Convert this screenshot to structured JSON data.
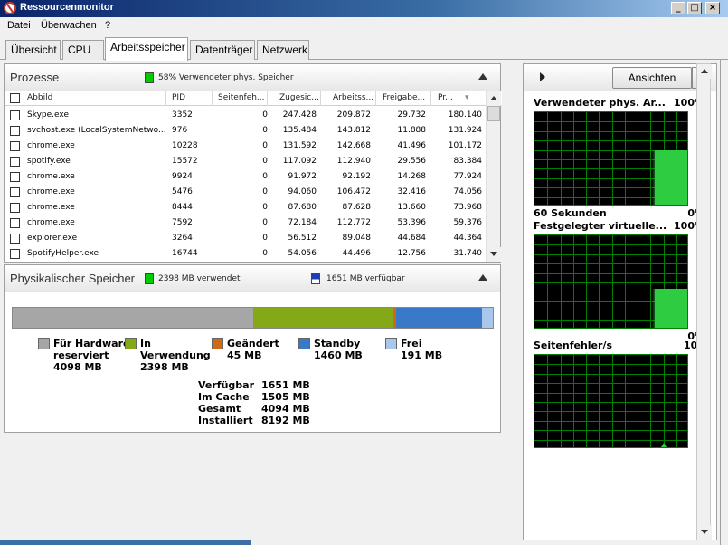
{
  "window": {
    "title": "Ressourcenmonitor"
  },
  "menu": [
    "Datei",
    "Überwachen",
    "?"
  ],
  "tabs": [
    "Übersicht",
    "CPU",
    "Arbeitsspeicher",
    "Datenträger",
    "Netzwerk"
  ],
  "active_tab": "Arbeitsspeicher",
  "processes": {
    "title": "Prozesse",
    "legend": "58% Verwendeter phys. Speicher",
    "legend_color": "#00cc00",
    "columns": [
      "Abbild",
      "PID",
      "Seitenfeh...",
      "Zugesic...",
      "Arbeitss...",
      "Freigabe...",
      "Pr..."
    ],
    "rows": [
      [
        "Skype.exe",
        "3352",
        "0",
        "247.428",
        "209.872",
        "29.732",
        "180.140"
      ],
      [
        "svchost.exe (LocalSystemNetwo...",
        "976",
        "0",
        "135.484",
        "143.812",
        "11.888",
        "131.924"
      ],
      [
        "chrome.exe",
        "10228",
        "0",
        "131.592",
        "142.668",
        "41.496",
        "101.172"
      ],
      [
        "spotify.exe",
        "15572",
        "0",
        "117.092",
        "112.940",
        "29.556",
        "83.384"
      ],
      [
        "chrome.exe",
        "9924",
        "0",
        "91.972",
        "92.192",
        "14.268",
        "77.924"
      ],
      [
        "chrome.exe",
        "5476",
        "0",
        "94.060",
        "106.472",
        "32.416",
        "74.056"
      ],
      [
        "chrome.exe",
        "8444",
        "0",
        "87.680",
        "87.628",
        "13.660",
        "73.968"
      ],
      [
        "chrome.exe",
        "7592",
        "0",
        "72.184",
        "112.772",
        "53.396",
        "59.376"
      ],
      [
        "explorer.exe",
        "3264",
        "0",
        "56.512",
        "89.048",
        "44.684",
        "44.364"
      ],
      [
        "SpotifyHelper.exe",
        "16744",
        "0",
        "54.056",
        "44.496",
        "12.756",
        "31.740"
      ]
    ]
  },
  "physical": {
    "title": "Physikalischer Speicher",
    "used_label": "2398 MB verwendet",
    "avail_label": "1651 MB verfügbar",
    "used_color": "#00cc00",
    "avail_color": "#1a3fb5",
    "bar_segments_mb": [
      {
        "name": "hardware",
        "mb": 4098,
        "color": "#a6a6a6"
      },
      {
        "name": "in-use",
        "mb": 2398,
        "color": "#85a818"
      },
      {
        "name": "modified",
        "mb": 45,
        "color": "#cc6b10"
      },
      {
        "name": "standby",
        "mb": 1460,
        "color": "#3a78c8"
      },
      {
        "name": "free",
        "mb": 191,
        "color": "#a9c7ea"
      }
    ],
    "legend": [
      {
        "label1": "Für Hardware",
        "label2": "reserviert",
        "value": "4098 MB",
        "color": "#a6a6a6"
      },
      {
        "label1": "In",
        "label2": "Verwendung",
        "value": "2398 MB",
        "color": "#85a818"
      },
      {
        "label1": "Geändert",
        "label2": "",
        "value": "45 MB",
        "color": "#cc6b10"
      },
      {
        "label1": "Standby",
        "label2": "",
        "value": "1460 MB",
        "color": "#3a78c8"
      },
      {
        "label1": "Frei",
        "label2": "",
        "value": "191 MB",
        "color": "#a9c7ea"
      }
    ],
    "summary": [
      {
        "label": "Verfügbar",
        "value": "1651 MB"
      },
      {
        "label": "Im Cache",
        "value": "1505 MB"
      },
      {
        "label": "Gesamt",
        "value": "4094 MB"
      },
      {
        "label": "Installiert",
        "value": "8192 MB"
      }
    ]
  },
  "right_panel": {
    "views_button": "Ansichten",
    "graphs": [
      {
        "title": "Verwendeter phys. Ar...",
        "max": "100%",
        "min": "0%",
        "bottom_left": "60 Sekunden",
        "fill_level": 0.58
      },
      {
        "title": "Festgelegter virtuelle...",
        "max": "100%",
        "min": "0%",
        "bottom_left": "",
        "fill_level": 0.41
      },
      {
        "title": "Seitenfehler/s",
        "max": "100",
        "min": "0",
        "bottom_left": "",
        "fill_level": 0.0
      }
    ]
  }
}
